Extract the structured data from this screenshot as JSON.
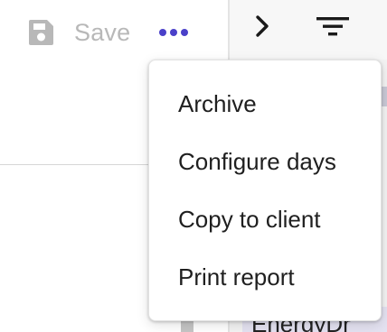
{
  "toolbar": {
    "save_label": "Save",
    "save_icon": "floppy-disk-icon",
    "more_icon": "ellipsis-icon",
    "accent_color": "#4a40c9"
  },
  "right_panel": {
    "expand_icon": "chevron-right-icon",
    "filter_icon": "filter-icon",
    "bottom_tag_text": "EnergyDr"
  },
  "menu": {
    "items": [
      {
        "label": "Archive"
      },
      {
        "label": "Configure days"
      },
      {
        "label": "Copy to client"
      },
      {
        "label": "Print report"
      }
    ]
  }
}
